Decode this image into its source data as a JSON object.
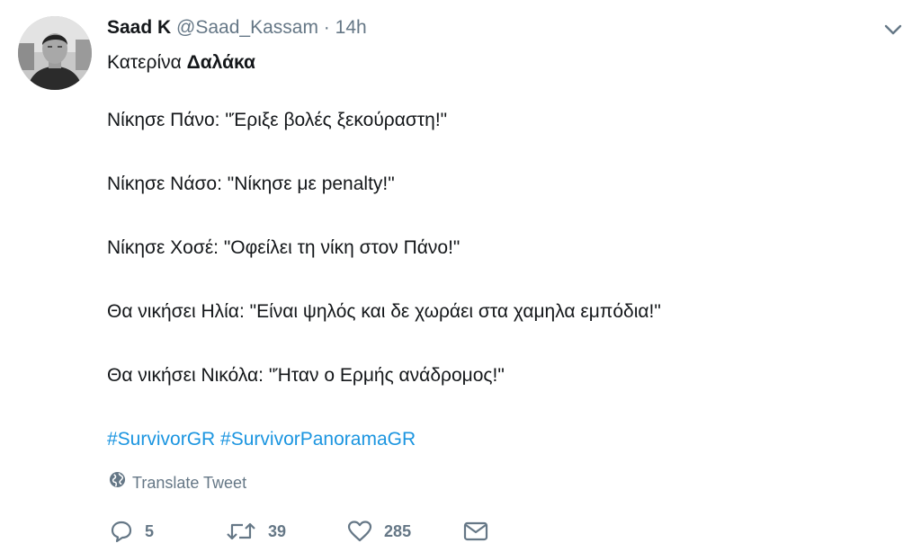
{
  "tweet": {
    "display_name": "Saad K",
    "handle": "@Saad_Kassam",
    "separator": "·",
    "time": "14h",
    "reply_prefix": "Κατερίνα",
    "reply_bold": "Δαλάκα",
    "lines": [
      "Νίκησε Πάνο: \"Έριξε βολές ξεκούραστη!\"",
      "Νίκησε Νάσο: \"Νίκησε με penalty!\"",
      "Νίκησε Χοσέ: \"Οφείλει τη νίκη στον Πάνο!\"",
      "Θα νικήσει Ηλία: \"Είναι ψηλός και δε χωράει στα χαμηλα εμπόδια!\"",
      "Θα νικήσει Νικόλα: \"Ήταν ο Ερμής ανάδρομος!\""
    ],
    "hashtags": [
      "#SurvivorGR",
      "#SurvivorPanoramaGR"
    ],
    "translate_label": "Translate Tweet"
  },
  "actions": {
    "reply_count": "5",
    "retweet_count": "39",
    "like_count": "285"
  },
  "icons": {
    "avatar": "profile-photo",
    "caret": "chevron-down-icon",
    "translate": "globe-icon",
    "reply": "reply-icon",
    "retweet": "retweet-icon",
    "like": "heart-icon",
    "message": "envelope-icon"
  },
  "colors": {
    "text": "#14171a",
    "secondary": "#657786",
    "link": "#1b95e0"
  }
}
